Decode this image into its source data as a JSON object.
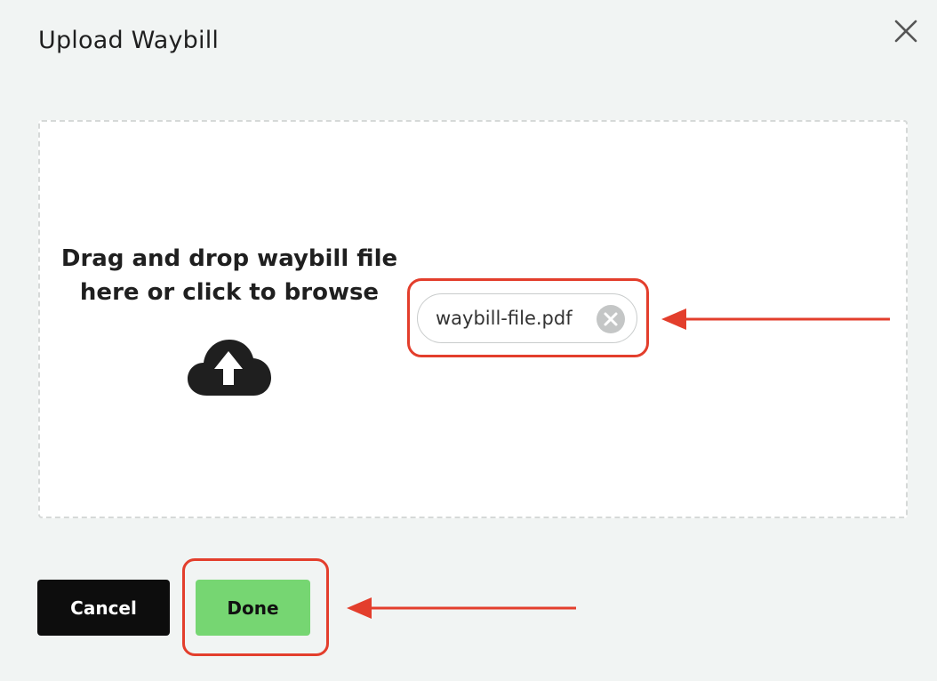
{
  "dialog": {
    "title": "Upload Waybill",
    "close_icon": "close-icon"
  },
  "dropzone": {
    "text": "Drag and drop waybill file here or click to browse",
    "icon": "cloud-upload-icon"
  },
  "file": {
    "name": "waybill-file.pdf",
    "remove_icon": "remove-circle-icon"
  },
  "footer": {
    "cancel_label": "Cancel",
    "done_label": "Done"
  },
  "colors": {
    "background": "#f1f4f3",
    "done_button": "#76d672",
    "cancel_button": "#0d0d0d",
    "annotation": "#e33e2c"
  }
}
